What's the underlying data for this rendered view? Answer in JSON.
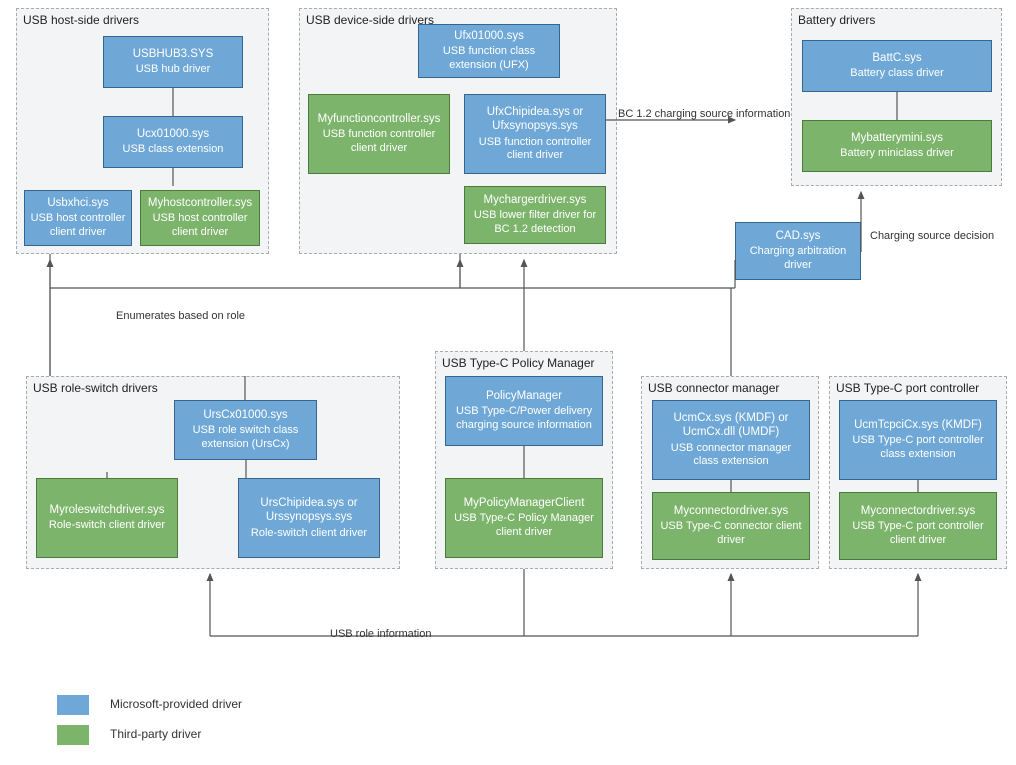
{
  "groups": {
    "host": {
      "title": "USB host-side drivers"
    },
    "device": {
      "title": "USB device-side drivers"
    },
    "battery": {
      "title": "Battery drivers"
    },
    "role": {
      "title": "USB role-switch drivers"
    },
    "policy": {
      "title": "USB Type-C  Policy Manager"
    },
    "connmgr": {
      "title": "USB connector manager"
    },
    "portctrl": {
      "title": "USB Type-C port controller"
    }
  },
  "boxes": {
    "usbhub3": {
      "t1": "USBHUB3.SYS",
      "t2": "USB hub driver"
    },
    "ucx": {
      "t1": "Ucx01000.sys",
      "t2": "USB class extension"
    },
    "usbxhci": {
      "t1": "Usbxhci.sys",
      "t2": "USB host controller client driver"
    },
    "myhostctrl": {
      "t1": "Myhostcontroller.sys",
      "t2": "USB host controller client driver"
    },
    "ufx": {
      "t1": "Ufx01000.sys",
      "t2": "USB function class extension (UFX)"
    },
    "myfuncctrl": {
      "t1": "Myfunctioncontroller.sys",
      "t2": "USB function controller client driver"
    },
    "ufxchip": {
      "t1": "UfxChipidea.sys or Ufxsynopsys.sys",
      "t2": "USB function controller client driver"
    },
    "mycharger": {
      "t1": "Mychargerdriver.sys",
      "t2": "USB lower filter driver for BC 1.2 detection"
    },
    "battc": {
      "t1": "BattC.sys",
      "t2": "Battery class driver"
    },
    "mybatt": {
      "t1": "Mybatterymini.sys",
      "t2": "Battery miniclass driver"
    },
    "cad": {
      "t1": "CAD.sys",
      "t2": "Charging arbitration driver"
    },
    "urscx": {
      "t1": "UrsCx01000.sys",
      "t2": "USB role switch class extension (UrsCx)"
    },
    "myrolesw": {
      "t1": "Myroleswitchdriver.sys",
      "t2": "Role-switch client driver"
    },
    "urschip": {
      "t1": "UrsChipidea.sys or Urssynopsys.sys",
      "t2": "Role-switch client driver"
    },
    "policymgr": {
      "t1": "PolicyManager",
      "t2": "USB Type-C/Power delivery charging source information"
    },
    "mypolicy": {
      "t1": "MyPolicyManagerClient",
      "t2": "USB Type-C Policy Manager client driver"
    },
    "ucmcx": {
      "t1": "UcmCx.sys (KMDF) or UcmCx.dll (UMDF)",
      "t2": "USB connector manager class extension"
    },
    "myconn": {
      "t1": "Myconnectordriver.sys",
      "t2": "USB Type-C connector client driver"
    },
    "ucmtcpci": {
      "t1": "UcmTcpciCx.sys (KMDF)",
      "t2": "USB Type-C port controller class extension"
    },
    "myconn2": {
      "t1": "Myconnectordriver.sys",
      "t2": "USB Type-C port controller client driver"
    }
  },
  "edges": {
    "bc12": "BC 1.2 charging source information",
    "chgsrc": "Charging source decision",
    "roleinfo": "USB role information",
    "enum": "Enumerates based on role"
  },
  "legend": {
    "ms": "Microsoft-provided driver",
    "tp": "Third-party driver"
  },
  "colors": {
    "ms_bg": "#6fa8d6",
    "ms_border": "#35668f",
    "tp_bg": "#7cb46b",
    "tp_border": "#4b7a3b",
    "group_bg": "#f3f4f5",
    "group_border": "#aaaaaa",
    "line": "#555"
  }
}
